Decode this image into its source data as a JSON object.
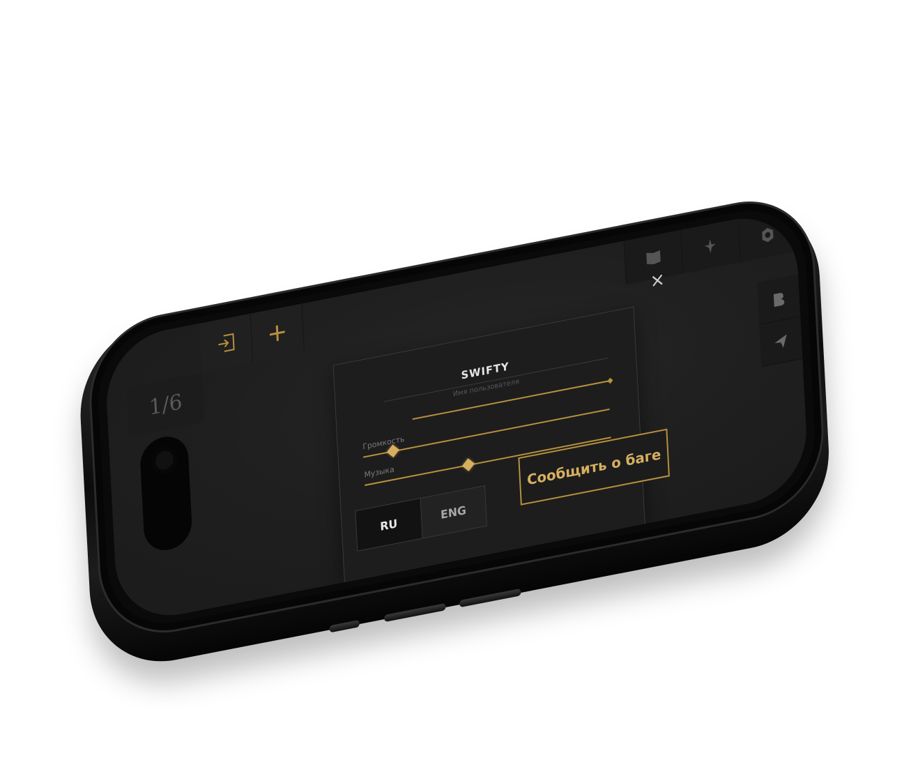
{
  "topbar_left": {
    "page_indicator": "1/6",
    "login_icon": "login-icon",
    "add_icon": "plus-icon"
  },
  "topbar_right": {
    "icons": [
      "book-icon",
      "sword-icon",
      "settings-icon"
    ]
  },
  "right_bar": {
    "icons": [
      "b-icon",
      "send-icon"
    ]
  },
  "settings_modal": {
    "username": "SWIFTY",
    "username_placeholder": "Имя пользователя",
    "volume_label": "Громкость",
    "volume_level": 0.12,
    "music_label": "Музыка",
    "music_level": 0.42,
    "language_options": [
      "RU",
      "ENG"
    ],
    "language_selected": "RU",
    "report_bug_label": "Сообщить о баге"
  },
  "colors": {
    "accent_gold": "#b8913e",
    "background": "#1f1f1f",
    "text_light": "#e6e6e6"
  }
}
